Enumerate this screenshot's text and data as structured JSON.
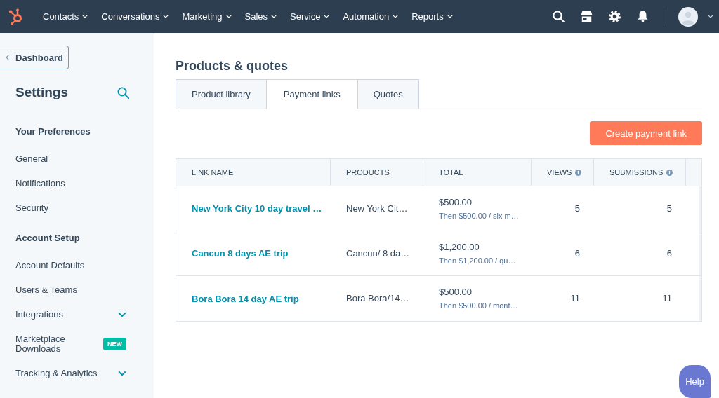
{
  "top_nav": {
    "menus": [
      "Contacts",
      "Conversations",
      "Marketing",
      "Sales",
      "Service",
      "Automation",
      "Reports"
    ]
  },
  "sidebar": {
    "back_button": "Dashboard",
    "title": "Settings",
    "sections": [
      {
        "heading": "Your Preferences",
        "items": [
          {
            "label": "General",
            "kind": "link"
          },
          {
            "label": "Notifications",
            "kind": "link"
          },
          {
            "label": "Security",
            "kind": "link"
          }
        ]
      },
      {
        "heading": "Account Setup",
        "items": [
          {
            "label": "Account Defaults",
            "kind": "link"
          },
          {
            "label": "Users & Teams",
            "kind": "link"
          },
          {
            "label": "Integrations",
            "kind": "group"
          },
          {
            "label": "Marketplace Downloads",
            "kind": "link",
            "badge": "NEW"
          },
          {
            "label": "Tracking & Analytics",
            "kind": "group"
          }
        ]
      }
    ]
  },
  "page": {
    "title": "Products & quotes",
    "tabs": [
      {
        "label": "Product library",
        "selected": false
      },
      {
        "label": "Payment links",
        "selected": true
      },
      {
        "label": "Quotes",
        "selected": false
      }
    ],
    "create_button": "Create payment link",
    "table": {
      "columns": [
        {
          "label": "LINK NAME",
          "info": false
        },
        {
          "label": "PRODUCTS",
          "info": false
        },
        {
          "label": "TOTAL",
          "info": false
        },
        {
          "label": "VIEWS",
          "info": true
        },
        {
          "label": "SUBMISSIONS",
          "info": true
        }
      ],
      "rows": [
        {
          "link_name": "New York City 10 day travel …",
          "products": "New York Cit…",
          "total": "$500.00",
          "billing": "Then $500.00 / six m…",
          "views": "5",
          "submissions": "5"
        },
        {
          "link_name": "Cancun 8 days AE trip",
          "products": "Cancun/ 8 da…",
          "total": "$1,200.00",
          "billing": "Then $1,200.00 / qu…",
          "views": "6",
          "submissions": "6"
        },
        {
          "link_name": "Bora Bora 14 day AE trip",
          "products": "Bora Bora/14…",
          "total": "$500.00",
          "billing": "Then $500.00 / mont…",
          "views": "11",
          "submissions": "11"
        }
      ]
    }
  },
  "help_button": "Help"
}
